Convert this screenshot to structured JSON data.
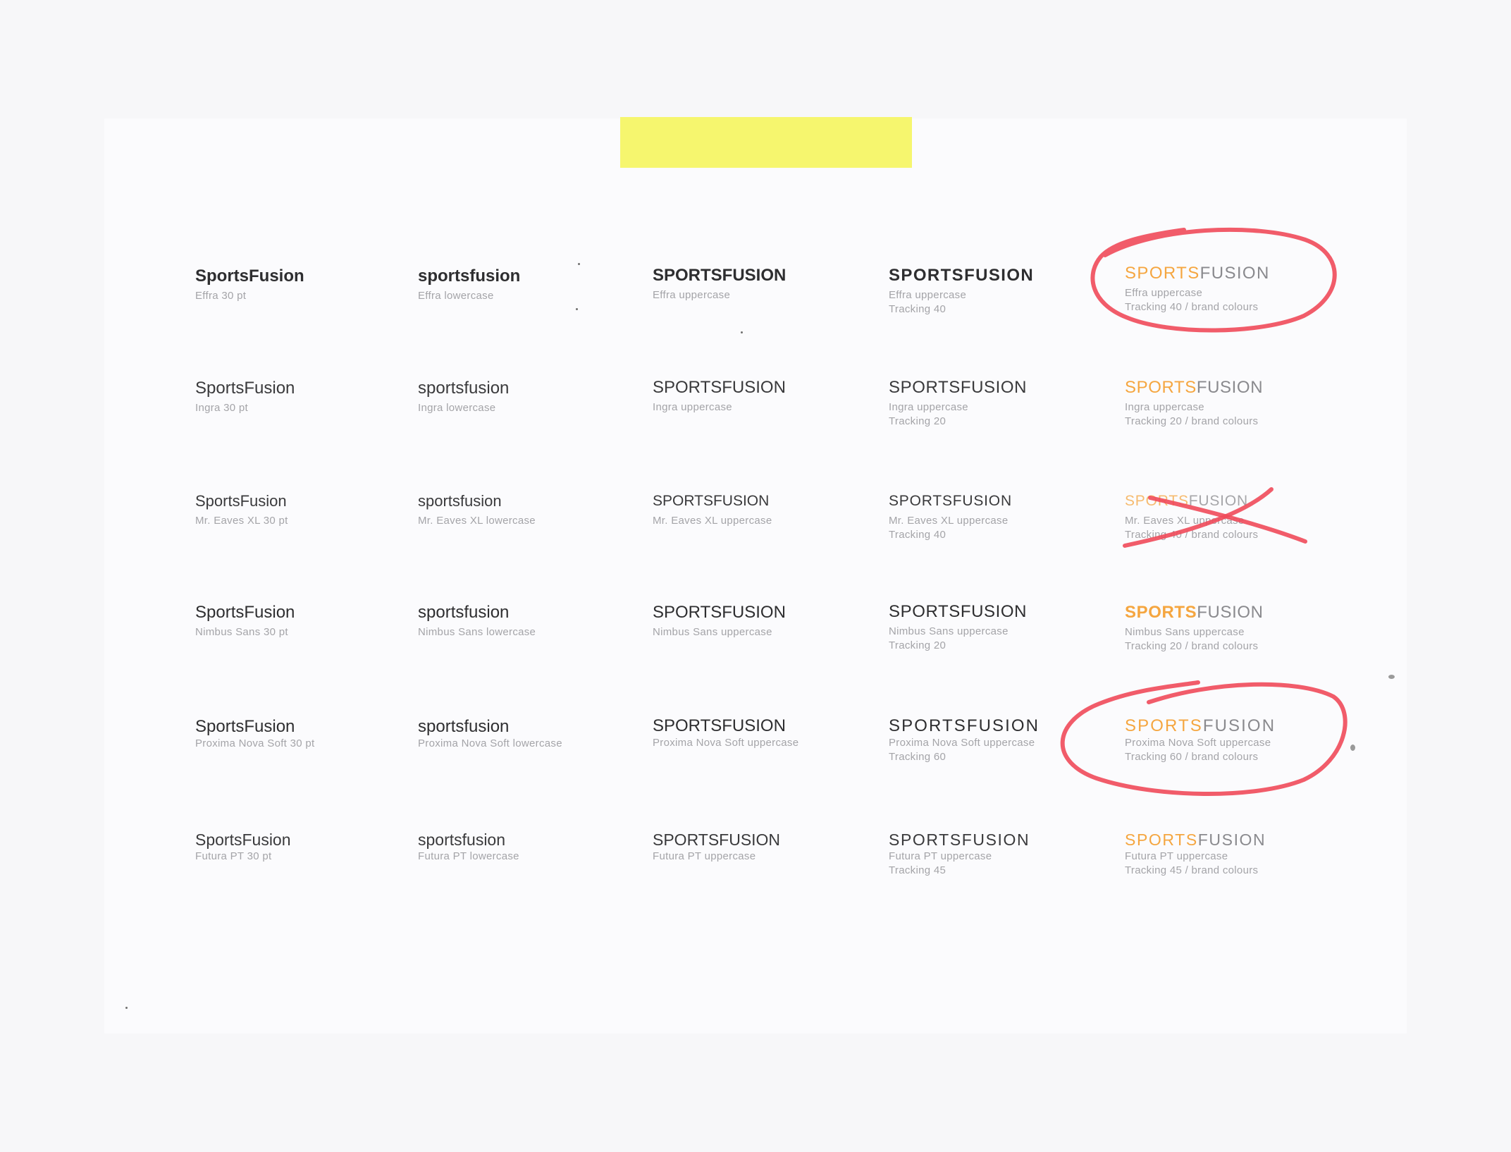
{
  "colors": {
    "background": "#f7f7f9",
    "paper": "#fbfbfd",
    "tape": "#f5f566",
    "sample_text": "#2e2e30",
    "caption_text": "#a4a4a8",
    "brand_orange": "#f5a640",
    "brand_grey": "#8a8a8e",
    "marker_red": "#ef4a5a"
  },
  "rows": [
    {
      "font": "Effra",
      "cells": [
        {
          "sample": "SportsFusion",
          "caption1": "Effra 30 pt",
          "caption2": ""
        },
        {
          "sample": "sportsfusion",
          "caption1": "Effra lowercase",
          "caption2": ""
        },
        {
          "sample": "SPORTSFUSION",
          "caption1": "Effra uppercase",
          "caption2": ""
        },
        {
          "sample": "SPORTSFUSION",
          "caption1": "Effra uppercase",
          "caption2": "Tracking 40"
        },
        {
          "sample_part1": "SPORTS",
          "sample_part2": "FUSION",
          "caption1": "Effra uppercase",
          "caption2": "Tracking 40 / brand colours",
          "annotation": "circled"
        }
      ]
    },
    {
      "font": "Ingra",
      "cells": [
        {
          "sample": "SportsFusion",
          "caption1": "Ingra 30 pt",
          "caption2": ""
        },
        {
          "sample": "sportsfusion",
          "caption1": "Ingra lowercase",
          "caption2": ""
        },
        {
          "sample": "SPORTSFUSION",
          "caption1": "Ingra uppercase",
          "caption2": ""
        },
        {
          "sample": "SPORTSFUSION",
          "caption1": "Ingra uppercase",
          "caption2": "Tracking 20"
        },
        {
          "sample_part1": "SPORTS",
          "sample_part2": "FUSION",
          "caption1": "Ingra uppercase",
          "caption2": "Tracking 20 / brand colours"
        }
      ]
    },
    {
      "font": "Mr. Eaves XL",
      "cells": [
        {
          "sample": "SportsFusion",
          "caption1": "Mr. Eaves XL 30 pt",
          "caption2": ""
        },
        {
          "sample": "sportsfusion",
          "caption1": "Mr. Eaves XL lowercase",
          "caption2": ""
        },
        {
          "sample": "SPORTSFUSION",
          "caption1": "Mr. Eaves XL uppercase",
          "caption2": ""
        },
        {
          "sample": "SPORTSFUSION",
          "caption1": "Mr. Eaves XL uppercase",
          "caption2": "Tracking 40"
        },
        {
          "sample_part1": "SPORTS",
          "sample_part2": "FUSION",
          "caption1": "Mr. Eaves XL uppercase",
          "caption2": "Tracking 40 / brand colours",
          "annotation": "crossed-out"
        }
      ]
    },
    {
      "font": "Nimbus Sans",
      "cells": [
        {
          "sample": "SportsFusion",
          "caption1": "Nimbus Sans 30 pt",
          "caption2": ""
        },
        {
          "sample": "sportsfusion",
          "caption1": "Nimbus Sans lowercase",
          "caption2": ""
        },
        {
          "sample": "SPORTSFUSION",
          "caption1": "Nimbus Sans uppercase",
          "caption2": ""
        },
        {
          "sample": "SPORTSFUSION",
          "caption1": "Nimbus Sans uppercase",
          "caption2": "Tracking 20"
        },
        {
          "sample_part1": "SPORTS",
          "sample_part2": "FUSION",
          "caption1": "Nimbus Sans uppercase",
          "caption2": "Tracking 20 / brand colours"
        }
      ]
    },
    {
      "font": "Proxima Nova Soft",
      "cells": [
        {
          "sample": "SportsFusion",
          "caption1": "Proxima Nova Soft 30 pt",
          "caption2": ""
        },
        {
          "sample": "sportsfusion",
          "caption1": "Proxima Nova Soft lowercase",
          "caption2": ""
        },
        {
          "sample": "SPORTSFUSION",
          "caption1": "Proxima Nova Soft uppercase",
          "caption2": ""
        },
        {
          "sample": "SPORTSFUSION",
          "caption1": "Proxima Nova Soft uppercase",
          "caption2": "Tracking 60"
        },
        {
          "sample_part1": "SPORTS",
          "sample_part2": "FUSION",
          "caption1": "Proxima Nova Soft uppercase",
          "caption2": "Tracking 60 / brand colours",
          "annotation": "circled"
        }
      ]
    },
    {
      "font": "Futura PT",
      "cells": [
        {
          "sample": "SportsFusion",
          "caption1": "Futura PT 30 pt",
          "caption2": ""
        },
        {
          "sample": "sportsfusion",
          "caption1": "Futura PT lowercase",
          "caption2": ""
        },
        {
          "sample": "SPORTSFUSION",
          "caption1": "Futura PT uppercase",
          "caption2": ""
        },
        {
          "sample": "SPORTSFUSION",
          "caption1": "Futura PT uppercase",
          "caption2": "Tracking 45"
        },
        {
          "sample_part1": "SPORTS",
          "sample_part2": "FUSION",
          "caption1": "Futura PT uppercase",
          "caption2": "Tracking 45 / brand colours"
        }
      ]
    }
  ]
}
